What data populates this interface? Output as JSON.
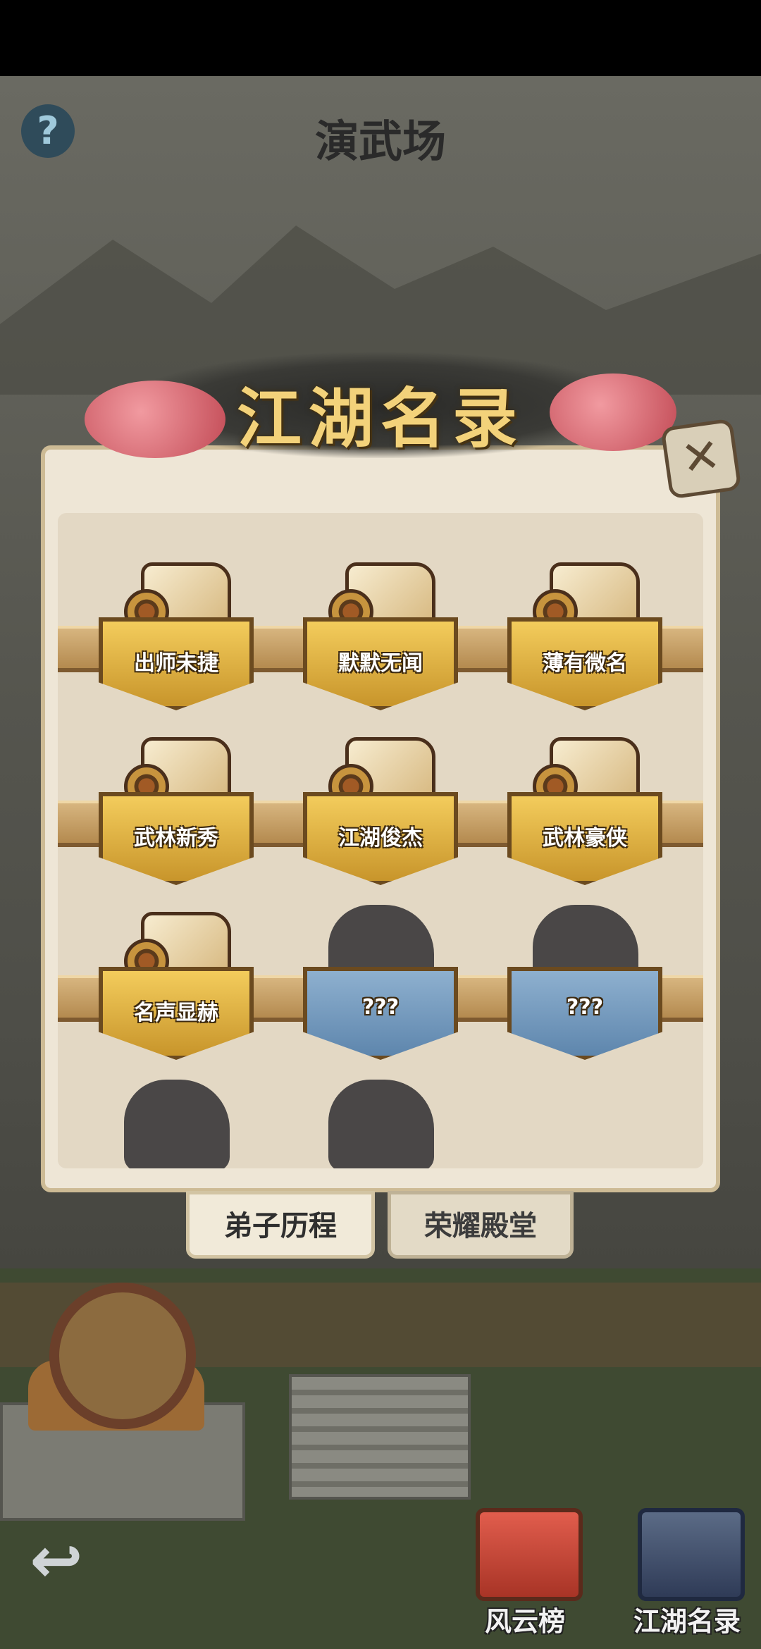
{
  "header": {
    "title": "演武场",
    "help_icon_text": "?"
  },
  "dialog": {
    "banner_title": "江湖名录",
    "close_icon_text": "✕",
    "items": [
      {
        "label": "出师未捷",
        "unlocked": true
      },
      {
        "label": "默默无闻",
        "unlocked": true
      },
      {
        "label": "薄有微名",
        "unlocked": true
      },
      {
        "label": "武林新秀",
        "unlocked": true
      },
      {
        "label": "江湖俊杰",
        "unlocked": true
      },
      {
        "label": "武林豪侠",
        "unlocked": true
      },
      {
        "label": "名声显赫",
        "unlocked": true
      },
      {
        "label": "???",
        "unlocked": false
      },
      {
        "label": "???",
        "unlocked": false
      }
    ],
    "tabs": [
      {
        "label": "弟子历程",
        "active": true
      },
      {
        "label": "荣耀殿堂",
        "active": false
      }
    ]
  },
  "bottom_bar": {
    "back_icon_text": "↩",
    "buttons": [
      {
        "label": "风云榜",
        "icon": "ranking-scroll-icon"
      },
      {
        "label": "江湖名录",
        "icon": "book-icon"
      }
    ]
  }
}
